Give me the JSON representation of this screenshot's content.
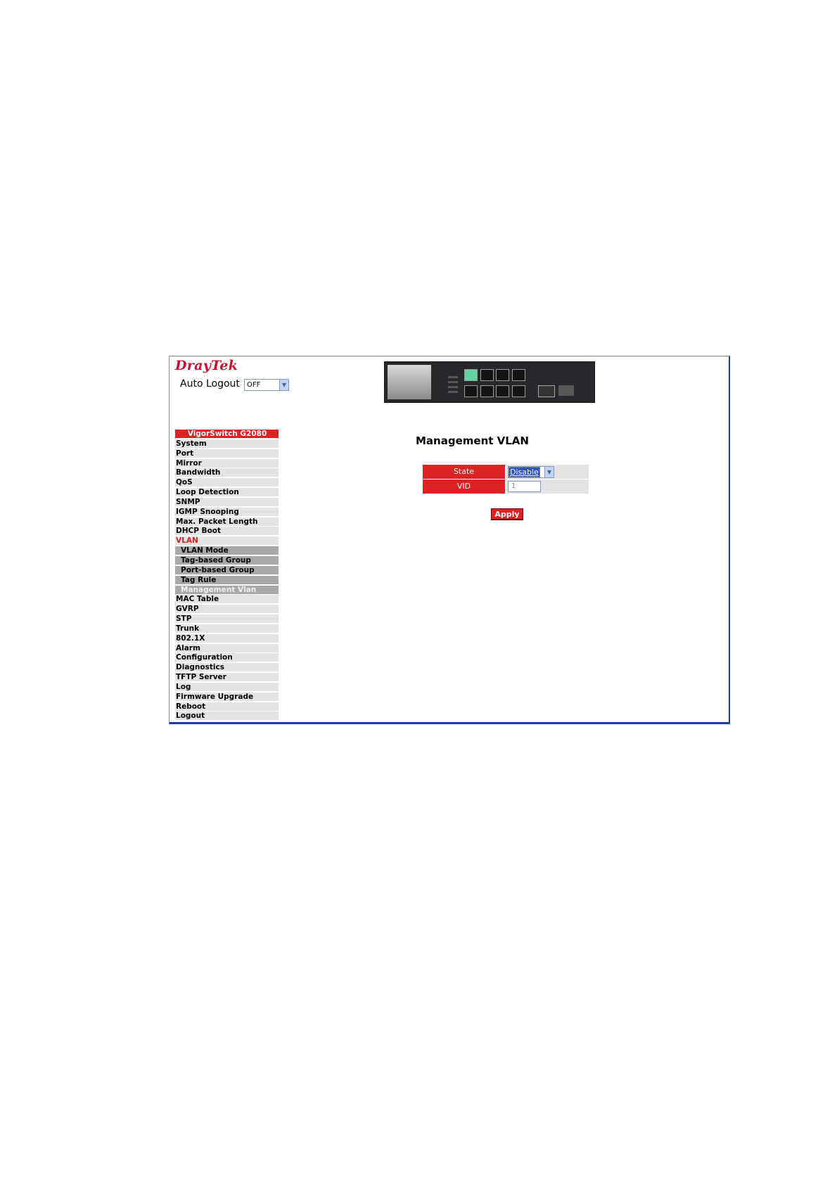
{
  "brand": {
    "logo": "DrayTek"
  },
  "auto_logout": {
    "label": "Auto Logout",
    "value": "OFF"
  },
  "menu": {
    "items": [
      {
        "label": "VigorSwitch G2080",
        "type": "header"
      },
      {
        "label": "System"
      },
      {
        "label": "Port"
      },
      {
        "label": "Mirror"
      },
      {
        "label": "Bandwidth"
      },
      {
        "label": "QoS"
      },
      {
        "label": "Loop Detection"
      },
      {
        "label": "SNMP"
      },
      {
        "label": "IGMP Snooping"
      },
      {
        "label": "Max. Packet Length"
      },
      {
        "label": "DHCP Boot"
      },
      {
        "label": "VLAN",
        "type": "active"
      },
      {
        "label": "VLAN Mode",
        "type": "sub"
      },
      {
        "label": "Tag-based Group",
        "type": "sub"
      },
      {
        "label": "Port-based Group",
        "type": "sub"
      },
      {
        "label": "Tag Rule",
        "type": "sub"
      },
      {
        "label": "Management Vlan",
        "type": "sub-current"
      },
      {
        "label": "MAC Table"
      },
      {
        "label": "GVRP"
      },
      {
        "label": "STP"
      },
      {
        "label": "Trunk"
      },
      {
        "label": "802.1X"
      },
      {
        "label": "Alarm"
      },
      {
        "label": "Configuration"
      },
      {
        "label": "Diagnostics"
      },
      {
        "label": "TFTP Server"
      },
      {
        "label": "Log"
      },
      {
        "label": "Firmware Upgrade"
      },
      {
        "label": "Reboot"
      },
      {
        "label": "Logout"
      }
    ]
  },
  "main": {
    "title": "Management VLAN",
    "state": {
      "label": "State",
      "value": "Disable"
    },
    "vid": {
      "label": "VID",
      "value": "1"
    },
    "apply_label": "Apply"
  },
  "colors": {
    "accent": "#dc2222",
    "menu_bg": "#e3e3e3",
    "submenu_bg": "#a9a9a9",
    "frame_border": "#1c3fa8"
  }
}
